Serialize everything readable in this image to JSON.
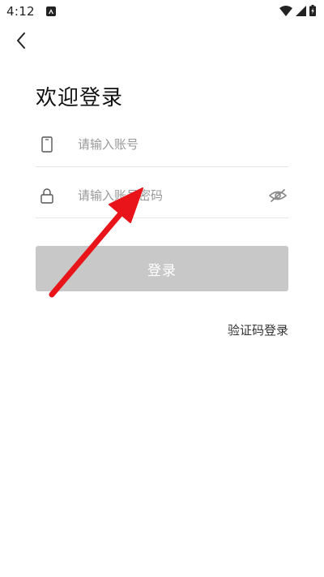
{
  "status_bar": {
    "time": "4:12",
    "icons": [
      "app-notification-icon",
      "wifi-icon",
      "signal-icon",
      "battery-icon"
    ]
  },
  "nav": {
    "back_icon": "chevron-left-icon"
  },
  "login": {
    "title": "欢迎登录",
    "account": {
      "icon": "phone-icon",
      "placeholder": "请输入账号",
      "value": ""
    },
    "password": {
      "icon": "lock-icon",
      "placeholder": "请输入账号密码",
      "value": "",
      "toggle_icon": "eye-hidden-icon"
    },
    "submit_label": "登录",
    "alt_login_label": "验证码登录"
  },
  "annotation": {
    "arrow_color": "#e8141a",
    "target": "password-field"
  },
  "colors": {
    "button_disabled": "#c8c8c8",
    "divider": "#e6e6e6",
    "placeholder": "#999999",
    "title": "#111111"
  }
}
